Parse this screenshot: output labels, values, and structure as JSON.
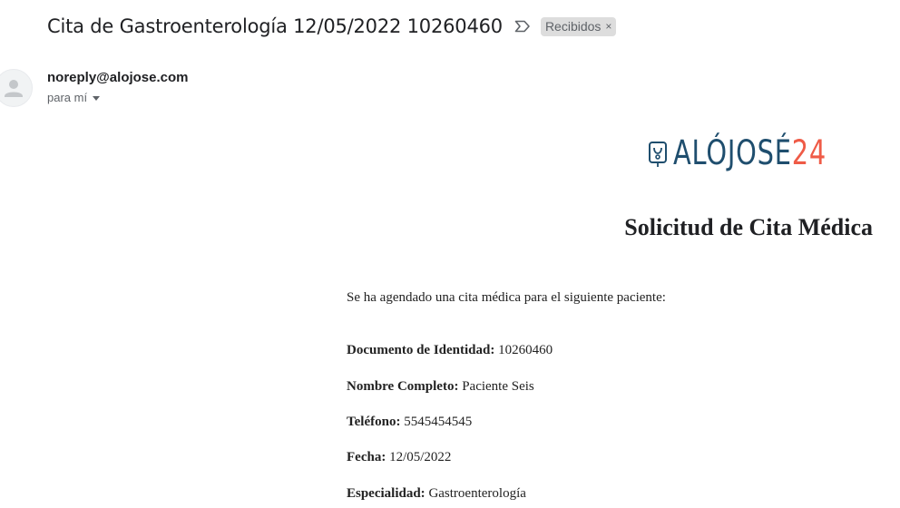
{
  "email": {
    "subject": "Cita de Gastroenterología 12/05/2022 10260460",
    "label": "Recibidos",
    "label_close": "×",
    "sender": "noreply@alojose.com",
    "recipient": "para mí"
  },
  "logo": {
    "text_main": "ALÓJOSÉ",
    "text_number": "24",
    "colors": {
      "primary": "#1f4e6e",
      "accent": "#ef5b47"
    }
  },
  "body": {
    "title": "Solicitud de Cita Médica",
    "intro": "Se ha agendado una cita médica para el siguiente paciente:",
    "fields": [
      {
        "label": "Documento de Identidad:",
        "value": "10260460"
      },
      {
        "label": "Nombre Completo:",
        "value": "Paciente Seis"
      },
      {
        "label": "Teléfono:",
        "value": "5545454545"
      },
      {
        "label": "Fecha:",
        "value": "12/05/2022"
      },
      {
        "label": "Especialidad:",
        "value": "Gastroenterología"
      }
    ]
  },
  "icons": {
    "important": "important-marker-icon",
    "avatar": "person-avatar-icon",
    "recipient_toggle": "caret-down-icon"
  }
}
